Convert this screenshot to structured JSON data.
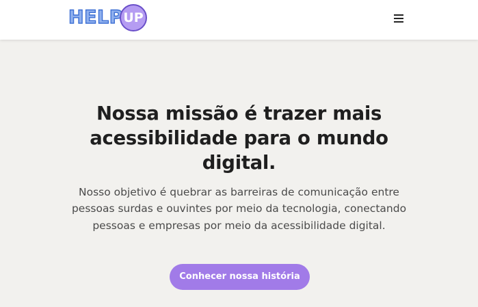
{
  "header": {
    "logo": {
      "text_main": "HELP",
      "text_badge": "UP"
    },
    "menu_icon": "hamburger-menu-icon"
  },
  "hero": {
    "title": "Nossa missão é trazer mais acessibilidade para o mundo digital.",
    "description": "Nosso objetivo é quebrar as barreiras de comunicação entre pessoas surdas e ouvintes por meio da tecnologia, conectando pessoas e empresas por meio da acessibilidade digital.",
    "cta_label": "Conhecer nossa história"
  },
  "colors": {
    "background": "#f2f1ee",
    "navbar": "#ffffff",
    "accent": "#a17be8",
    "logo_blue": "#8fb0ee",
    "logo_purple": "#b59cf2"
  }
}
